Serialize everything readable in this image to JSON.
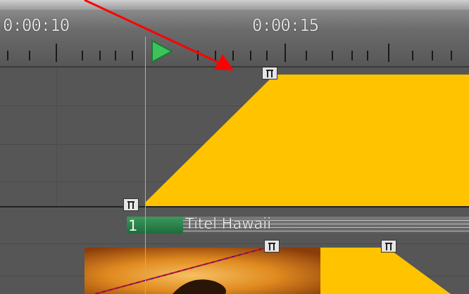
{
  "ruler": {
    "timecodes": [
      "0:00:10",
      "0:00:15"
    ]
  },
  "clip": {
    "number": "1",
    "name": "Titel Hawaii"
  },
  "colors": {
    "opacity_fill": "#ffc300",
    "annotation_arrow": "#ff0000",
    "clip_green": "#2e8b57",
    "play_marker": "#3cc45a"
  },
  "icons": [
    "play-marker-icon",
    "keyframe-icon",
    "annotation-arrow"
  ]
}
